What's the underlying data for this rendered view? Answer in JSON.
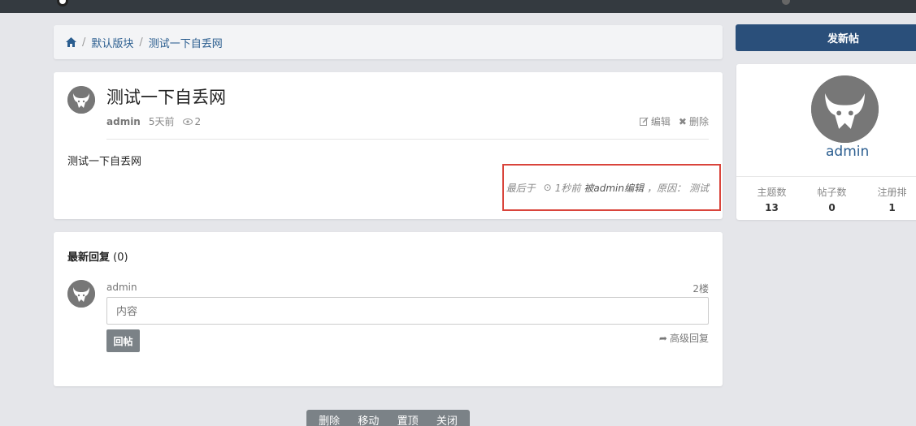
{
  "breadcrumb": {
    "home_icon": "home-icon",
    "items": [
      "默认版块",
      "测试一下自丢网"
    ]
  },
  "post": {
    "title": "测试一下自丢网",
    "author": "admin",
    "time": "5天前",
    "views": "2",
    "edit_label": "编辑",
    "delete_label": "删除",
    "body": "测试一下自丢网",
    "edit_note": {
      "prefix": "最后于",
      "time": "1秒前",
      "editor": "被admin编辑",
      "reason_label": "，原因：",
      "reason": "测试"
    }
  },
  "replies": {
    "title": "最新回复",
    "count": "(0)",
    "user": "admin",
    "floor": "2楼",
    "input_placeholder": "内容",
    "submit_label": "回帖",
    "advanced_label": "高级回复"
  },
  "admin_actions": [
    "删除",
    "移动",
    "置顶",
    "关闭"
  ],
  "sidebar": {
    "new_post_label": "发新帖",
    "username": "admin",
    "stats": [
      {
        "label": "主题数",
        "value": "13"
      },
      {
        "label": "帖子数",
        "value": "0"
      },
      {
        "label": "注册排",
        "value": "1"
      }
    ]
  },
  "colors": {
    "accent": "#2a4f7a",
    "link": "#2a5d8f",
    "highlight_border": "#d9443b",
    "button_gray": "#7b8287"
  }
}
